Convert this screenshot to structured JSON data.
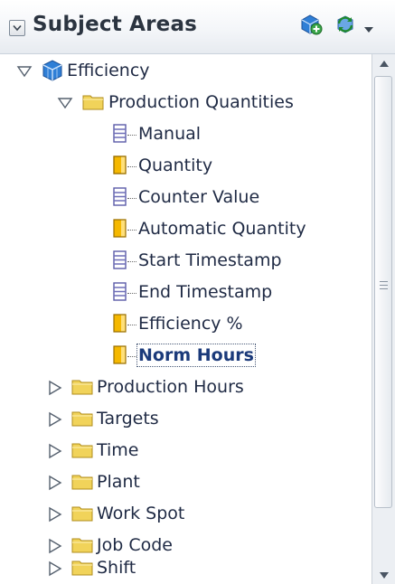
{
  "header": {
    "title": "Subject Areas",
    "collapse_icon": "chevron-down-box-icon",
    "actions": [
      {
        "name": "new-subject-area-button",
        "icon": "add-cube-icon"
      },
      {
        "name": "refresh-button",
        "icon": "refresh-icon"
      },
      {
        "name": "header-menu-button",
        "icon": "caret-down-icon"
      }
    ]
  },
  "tree": {
    "root": {
      "label": "Efficiency",
      "icon": "subject-area-cube-icon",
      "expanded": true
    },
    "folders": [
      {
        "label": "Production Quantities",
        "expanded": true,
        "items": [
          {
            "label": "Manual",
            "type": "attribute",
            "icon": "attribute-column-icon"
          },
          {
            "label": "Quantity",
            "type": "measure",
            "icon": "measure-column-icon"
          },
          {
            "label": "Counter Value",
            "type": "attribute",
            "icon": "attribute-column-icon"
          },
          {
            "label": "Automatic Quantity",
            "type": "measure",
            "icon": "measure-column-icon"
          },
          {
            "label": "Start Timestamp",
            "type": "attribute",
            "icon": "attribute-column-icon"
          },
          {
            "label": "End Timestamp",
            "type": "attribute",
            "icon": "attribute-column-icon"
          },
          {
            "label": "Efficiency %",
            "type": "measure",
            "icon": "measure-column-icon"
          },
          {
            "label": "Norm Hours",
            "type": "measure",
            "icon": "measure-column-icon",
            "selected": true
          }
        ]
      },
      {
        "label": "Production Hours",
        "expanded": false
      },
      {
        "label": "Targets",
        "expanded": false
      },
      {
        "label": "Time",
        "expanded": false
      },
      {
        "label": "Plant",
        "expanded": false
      },
      {
        "label": "Work Spot",
        "expanded": false
      },
      {
        "label": "Job Code",
        "expanded": false
      },
      {
        "label": "Shift",
        "expanded": false
      }
    ]
  },
  "colors": {
    "folder": "#f1d35a",
    "root_cube": "#2f7fd6",
    "attribute_icon": "#6f6fb8",
    "measure_icon": "#f5b800",
    "selected_text": "#1b3a7a"
  }
}
